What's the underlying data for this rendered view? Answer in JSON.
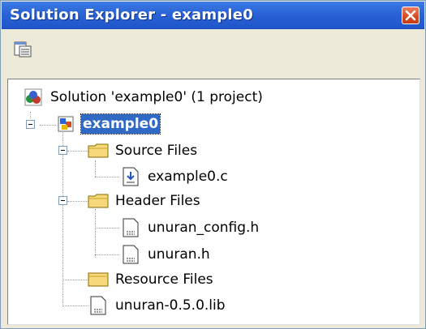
{
  "window": {
    "title": "Solution Explorer - example0"
  },
  "toolbar": {
    "properties_icon": "properties-icon"
  },
  "tree": {
    "solution": {
      "label": "Solution 'example0' (1 project)",
      "icon": "solution-icon"
    },
    "project": {
      "label": "example0",
      "icon": "project-icon"
    },
    "source_files": {
      "label": "Source Files",
      "icon": "folder-icon"
    },
    "source_file_1": {
      "label": "example0.c",
      "icon": "c-source-file-icon"
    },
    "header_files": {
      "label": "Header Files",
      "icon": "folder-icon"
    },
    "header_file_1": {
      "label": "unuran_config.h",
      "icon": "header-file-icon"
    },
    "header_file_2": {
      "label": "unuran.h",
      "icon": "header-file-icon"
    },
    "resource_files": {
      "label": "Resource Files",
      "icon": "folder-icon"
    },
    "lib_file": {
      "label": "unuran-0.5.0.lib",
      "icon": "lib-file-icon"
    }
  },
  "colors": {
    "titlebar": "#2a63d6",
    "selection": "#316ac5",
    "close": "#d84a20"
  }
}
